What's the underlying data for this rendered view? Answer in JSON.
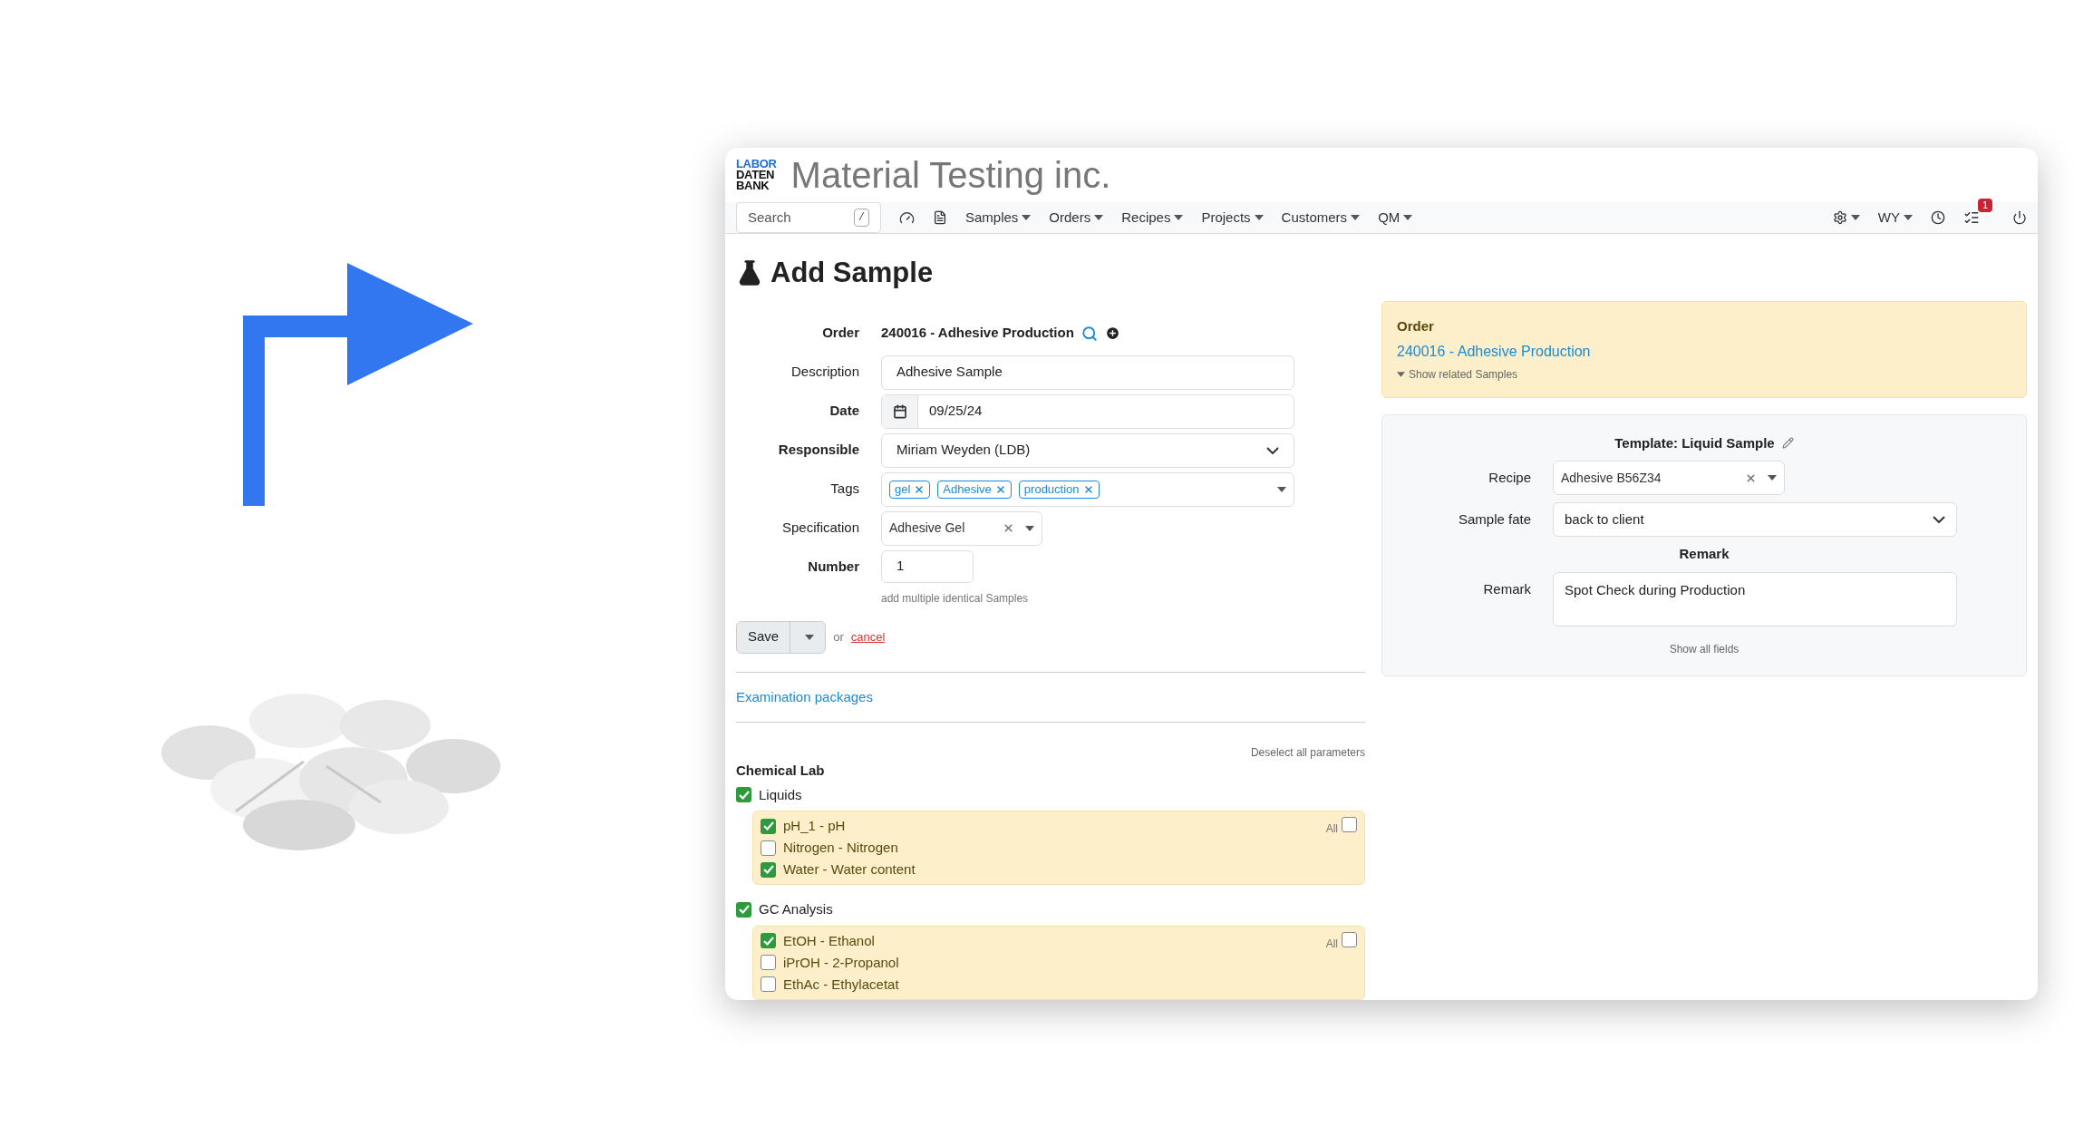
{
  "logo": [
    "LABOR",
    "DATEN",
    "BANK"
  ],
  "brand": "Material Testing inc.",
  "nav": {
    "search": {
      "placeholder": "Search",
      "key": "/"
    },
    "menus": [
      "Samples",
      "Orders",
      "Recipes",
      "Projects",
      "Customers",
      "QM"
    ],
    "user": "WY",
    "task_count": "1"
  },
  "title": "Add Sample",
  "form": [
    {
      "kind": "static",
      "label": "Order",
      "required": true,
      "value": "240016 - Adhesive Production"
    },
    {
      "kind": "text",
      "label": "Description",
      "required": false,
      "value": "Adhesive Sample"
    },
    {
      "kind": "date",
      "label": "Date",
      "required": true,
      "value": "09/25/24"
    },
    {
      "kind": "select",
      "label": "Responsible",
      "required": true,
      "value": "Miriam Weyden (LDB)"
    },
    {
      "kind": "tags",
      "label": "Tags",
      "required": false,
      "tags": [
        "gel",
        "Adhesive",
        "production"
      ]
    },
    {
      "kind": "combo",
      "label": "Specification",
      "required": false,
      "value": "Adhesive Gel"
    },
    {
      "kind": "number",
      "label": "Number",
      "required": true,
      "value": "1",
      "hint": "add multiple identical Samples"
    }
  ],
  "actions": {
    "save": "Save",
    "or": "or",
    "cancel": "cancel"
  },
  "packages_link": "Examination packages",
  "deselect": "Deselect all parameters",
  "lab": "Chemical Lab",
  "groups": [
    {
      "name": "Liquids",
      "checked": true,
      "all": "All",
      "all_checked": false,
      "items": [
        {
          "label": "pH_1 - pH",
          "checked": true
        },
        {
          "label": "Nitrogen - Nitrogen",
          "checked": false
        },
        {
          "label": "Water - Water content",
          "checked": true
        }
      ]
    },
    {
      "name": "GC Analysis",
      "checked": true,
      "all": "All",
      "all_checked": false,
      "items": [
        {
          "label": "EtOH - Ethanol",
          "checked": true
        },
        {
          "label": "iPrOH - 2-Propanol",
          "checked": false
        },
        {
          "label": "EthAc - Ethylacetat",
          "checked": false
        }
      ]
    }
  ],
  "order_panel": {
    "heading": "Order",
    "link": "240016 - Adhesive Production",
    "toggle": "Show related Samples"
  },
  "template": {
    "title": "Template: Liquid Sample",
    "recipe": {
      "label": "Recipe",
      "value": "Adhesive B56Z34"
    },
    "fate": {
      "label": "Sample fate",
      "value": "back to client"
    },
    "remark_heading": "Remark",
    "remark": {
      "label": "Remark",
      "value": "Spot Check during Production"
    },
    "show_all": "Show all fields"
  }
}
